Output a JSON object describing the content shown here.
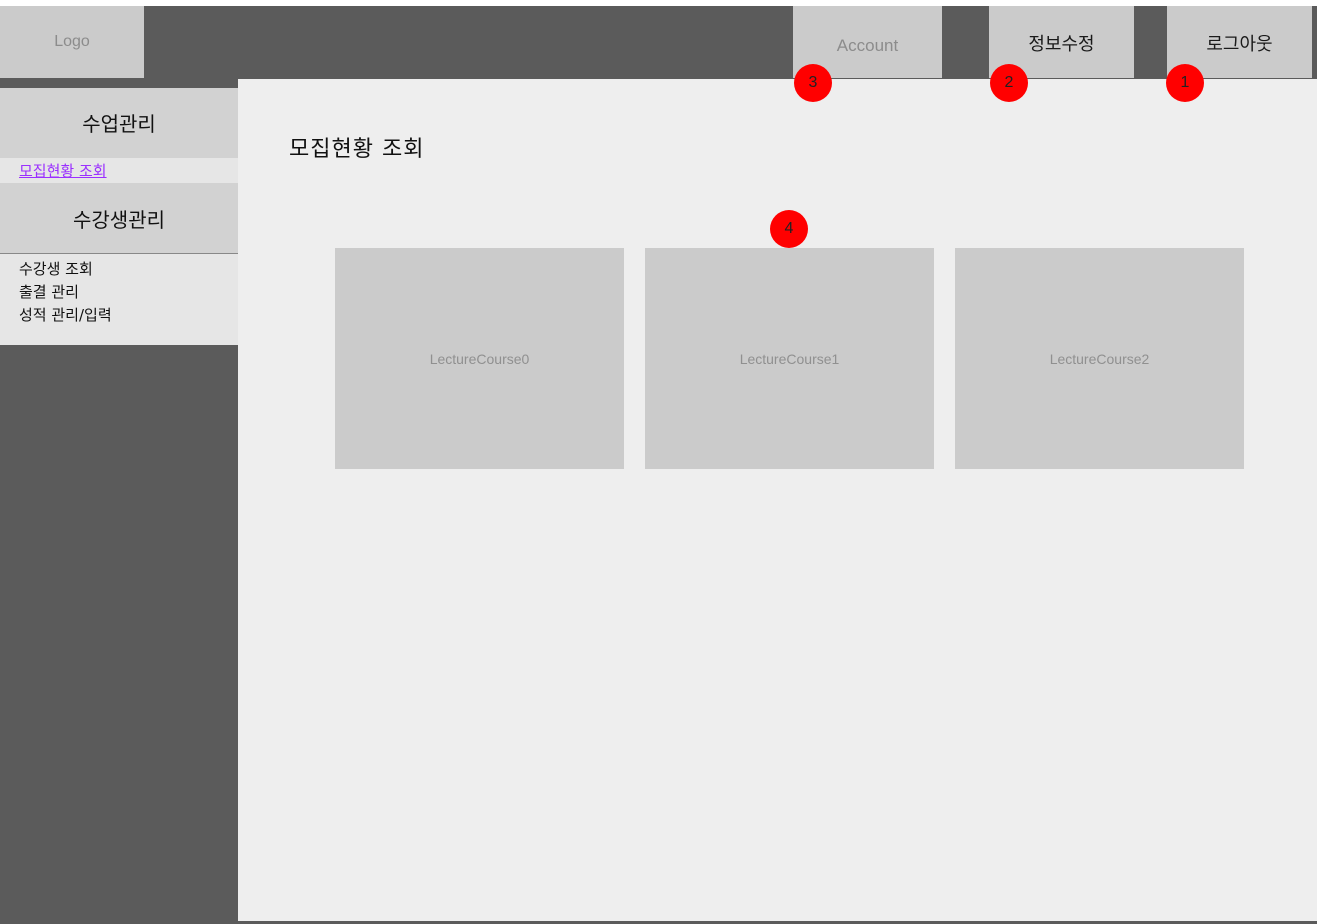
{
  "header": {
    "logo": "Logo",
    "account_label": "Account",
    "edit_info_label": "정보수정",
    "logout_label": "로그아웃"
  },
  "sidebar": {
    "section1_title": "수업관리",
    "section1_items": [
      "모집현황 조회"
    ],
    "section2_title": "수강생관리",
    "section2_items": [
      "수강생 조회",
      "출결 관리",
      "성적 관리/입력"
    ]
  },
  "main": {
    "title": "모집현황 조회",
    "cards": [
      "LectureCourse0",
      "LectureCourse1",
      "LectureCourse2"
    ]
  },
  "annotations": [
    "1",
    "2",
    "3",
    "4"
  ],
  "colors": {
    "frame": "#5b5b5b",
    "panel": "#cbcbcb",
    "content_bg": "#eeeeee",
    "link": "#9b30ff",
    "badge": "#ff0000"
  }
}
